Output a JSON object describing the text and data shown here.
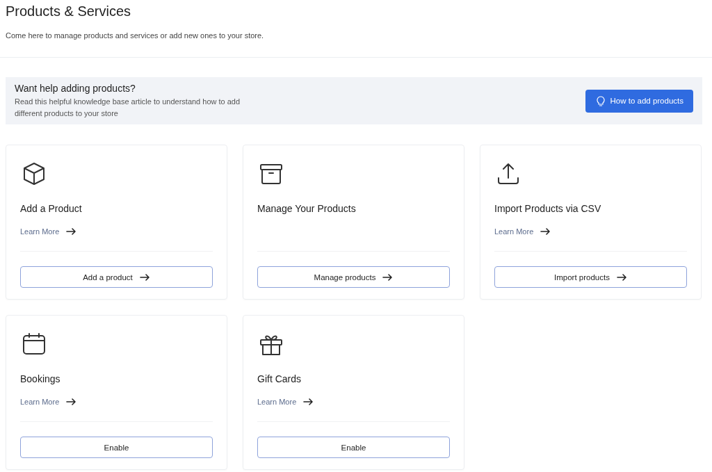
{
  "header": {
    "title": "Products & Services",
    "subtitle": "Come here to manage products and services or add new ones to your store."
  },
  "banner": {
    "title": "Want help adding products?",
    "text": "Read this helpful knowledge base article to understand how to add different products to your store",
    "button": "How to add products"
  },
  "cards": [
    {
      "title": "Add a Product",
      "learn_more": "Learn More",
      "button": {
        "label": "Add a product",
        "arrow": true
      }
    },
    {
      "title": "Manage Your Products",
      "button": {
        "label": "Manage products",
        "arrow": true
      }
    },
    {
      "title": "Import Products via CSV",
      "learn_more": "Learn More",
      "button": {
        "label": "Import products",
        "arrow": true
      }
    },
    {
      "title": "Bookings",
      "learn_more": "Learn More",
      "button": {
        "label": "Enable",
        "arrow": false
      }
    },
    {
      "title": "Gift Cards",
      "learn_more": "Learn More",
      "button": {
        "label": "Enable",
        "arrow": false
      }
    }
  ]
}
